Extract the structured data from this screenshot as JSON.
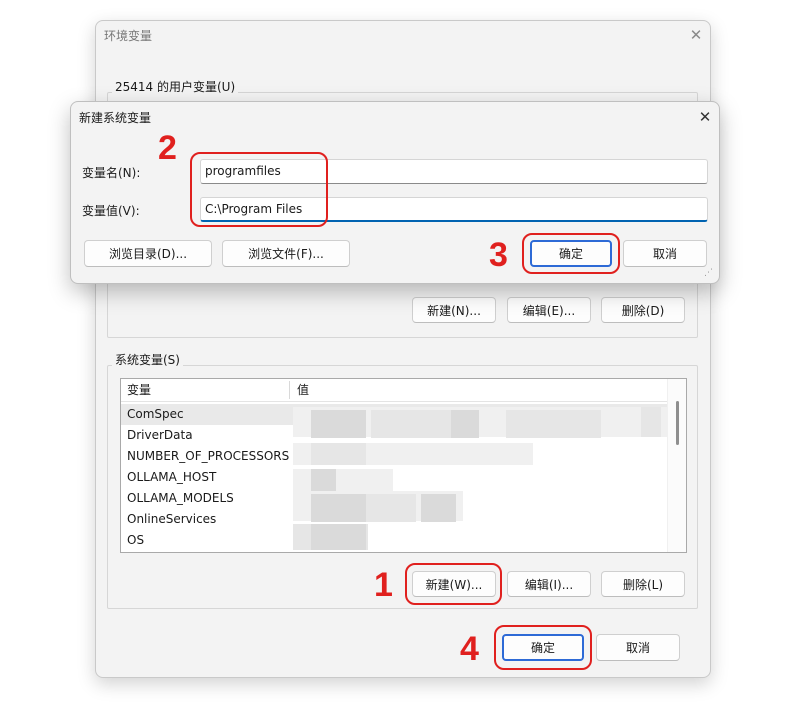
{
  "env_window": {
    "title": "环境变量",
    "user_group_label": "25414 的用户变量(U)",
    "user_buttons": {
      "new": "新建(N)...",
      "edit": "编辑(E)...",
      "delete": "删除(D)"
    },
    "system_group_label": "系统变量(S)",
    "system_list": {
      "columns": [
        "变量",
        "值"
      ],
      "rows": [
        "ComSpec",
        "DriverData",
        "NUMBER_OF_PROCESSORS",
        "OLLAMA_HOST",
        "OLLAMA_MODELS",
        "OnlineServices",
        "OS"
      ],
      "selected_row": 0
    },
    "system_buttons": {
      "new": "新建(W)...",
      "edit": "编辑(I)...",
      "delete": "删除(L)"
    },
    "footer_buttons": {
      "ok": "确定",
      "cancel": "取消"
    }
  },
  "new_dialog": {
    "title": "新建系统变量",
    "name_label": "变量名(N):",
    "name_value": "programfiles",
    "value_label": "变量值(V):",
    "value_value": "C:\\Program Files",
    "browse_dir": "浏览目录(D)...",
    "browse_file": "浏览文件(F)...",
    "ok": "确定",
    "cancel": "取消"
  },
  "annotations": {
    "step1": "1",
    "step2": "2",
    "step3": "3",
    "step4": "4",
    "color": "#e0201e"
  },
  "icons": {
    "close": "close-icon",
    "resize": "resize-grip-icon"
  }
}
